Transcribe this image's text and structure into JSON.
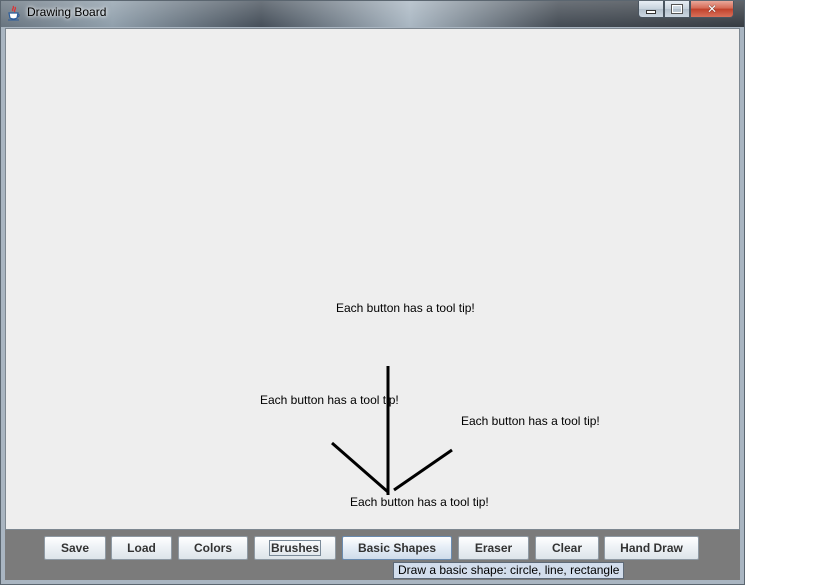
{
  "window": {
    "title": "Drawing Board",
    "icon": "java-cup-icon",
    "controls": {
      "minimize_icon": "minimize-icon",
      "maximize_icon": "maximize-icon",
      "close_icon": "close-icon"
    }
  },
  "canvas": {
    "background": "#eeeeee",
    "texts": [
      "Each button has a tool tip!",
      "Each button has a tool tip!",
      "Each button has a tool tip!",
      "Each button has a tool tip!"
    ],
    "stroke_color": "#000000"
  },
  "toolbar": {
    "background": "#7b7b7b",
    "buttons": [
      {
        "label": "Save"
      },
      {
        "label": "Load"
      },
      {
        "label": "Colors"
      },
      {
        "label": "Brushes"
      },
      {
        "label": "Basic Shapes"
      },
      {
        "label": "Eraser"
      },
      {
        "label": "Clear"
      },
      {
        "label": "Hand Draw"
      }
    ]
  },
  "tooltip": {
    "text": "Draw a basic shape: circle, line, rectangle"
  }
}
